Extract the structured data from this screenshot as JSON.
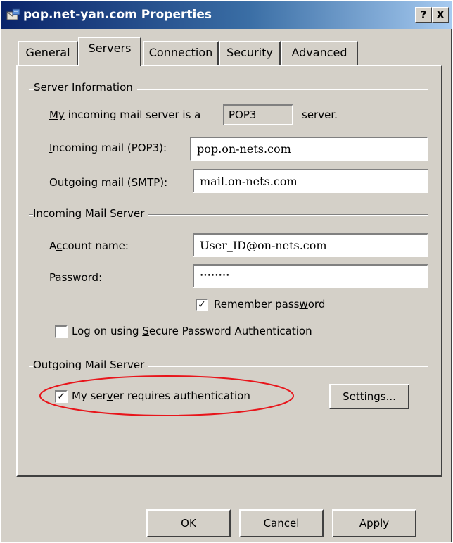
{
  "window": {
    "title": "pop.net-yan.com Properties",
    "help_label": "?",
    "close_label": "X"
  },
  "tabs": [
    {
      "label": "General",
      "active": false
    },
    {
      "label": "Servers",
      "active": true
    },
    {
      "label": "Connection",
      "active": false
    },
    {
      "label": "Security",
      "active": false
    },
    {
      "label": "Advanced",
      "active": false
    }
  ],
  "server_info": {
    "group_label": "Server Information",
    "incoming_type_prefix": "My",
    "incoming_type_rest": " incoming mail server is a",
    "incoming_type_value": "POP3",
    "incoming_type_suffix": "server.",
    "incoming_label_accel": "I",
    "incoming_label_rest": "ncoming mail (POP3):",
    "incoming_value": "pop.on-nets.com",
    "outgoing_label_pre": "O",
    "outgoing_label_accel": "u",
    "outgoing_label_rest": "tgoing mail (SMTP):",
    "outgoing_value": "mail.on-nets.com"
  },
  "incoming_server": {
    "group_label": "Incoming Mail Server",
    "account_label_pre": "A",
    "account_label_accel": "c",
    "account_label_rest": "count name:",
    "account_value": "User_ID@on-nets.com",
    "password_label_accel": "P",
    "password_label_rest": "assword:",
    "password_value": "********",
    "remember_label_pre": "Remember pass",
    "remember_label_accel": "w",
    "remember_label_rest": "ord",
    "remember_checked": true,
    "spa_label_pre": "Log on using ",
    "spa_label_accel": "S",
    "spa_label_rest": "ecure Password Authentication",
    "spa_checked": false
  },
  "outgoing_server": {
    "group_label": "Outgoing Mail Server",
    "auth_label_pre": "My ser",
    "auth_label_accel": "v",
    "auth_label_rest": "er requires authentication",
    "auth_checked": true,
    "settings_label_accel": "S",
    "settings_label_pre": "",
    "settings_label_rest": "ettings..."
  },
  "buttons": {
    "ok_label": "OK",
    "cancel_label": "Cancel",
    "apply_label_accel": "A",
    "apply_label_rest": "pply"
  },
  "colors": {
    "highlight_oval": "#e8151b",
    "title_gradient_start": "#0a246a"
  }
}
